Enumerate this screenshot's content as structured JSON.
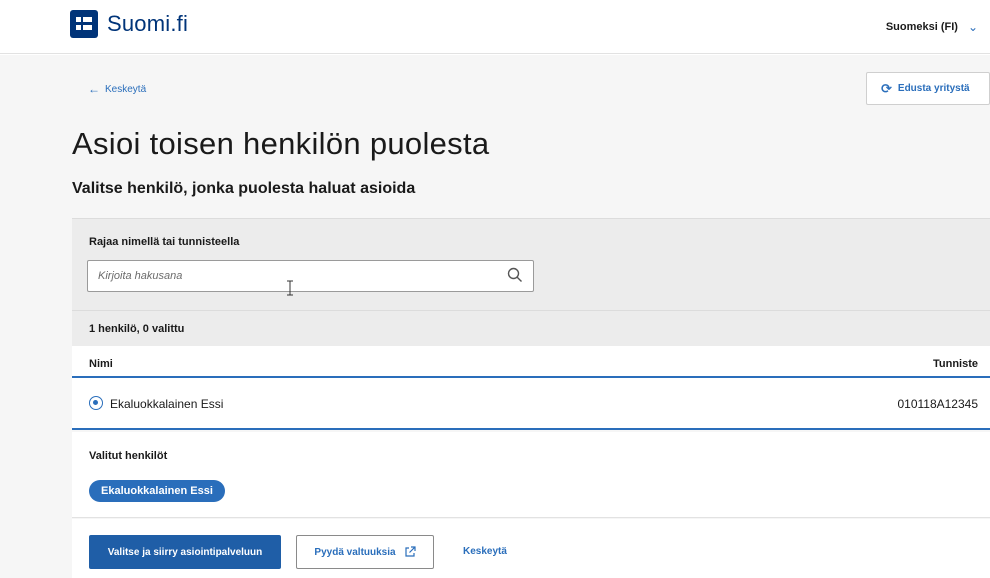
{
  "header": {
    "logo_text": "Suomi.fi",
    "language": "Suomeksi (FI)"
  },
  "nav": {
    "back_label": "Keskeytä",
    "represent_company_label": "Edusta yritystä"
  },
  "page": {
    "title": "Asioi toisen henkilön puolesta",
    "subtitle": "Valitse henkilö, jonka puolesta haluat asioida"
  },
  "filter": {
    "label": "Rajaa nimellä tai tunnisteella",
    "placeholder": "Kirjoita hakusana",
    "value": ""
  },
  "results": {
    "count_text": "1 henkilö, 0 valittu",
    "columns": {
      "name": "Nimi",
      "id": "Tunniste"
    },
    "rows": [
      {
        "name": "Ekaluokkalainen Essi",
        "id": "010118A12345",
        "selected": true
      }
    ]
  },
  "selected_section": {
    "label": "Valitut henkilöt",
    "chips": [
      "Ekaluokkalainen Essi"
    ]
  },
  "actions": {
    "primary_label": "Valitse ja siirry asiointipalveluun",
    "secondary_label": "Pyydä valtuuksia",
    "cancel_label": "Keskeytä"
  },
  "colors": {
    "brand_navy": "#003479",
    "link_blue": "#2a6ebb",
    "primary_button": "#1f5ea7"
  }
}
